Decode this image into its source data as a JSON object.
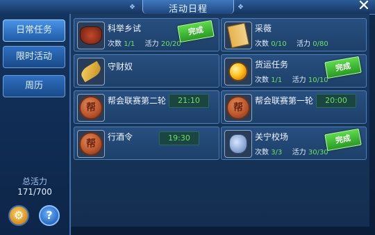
{
  "window": {
    "title": "活动日程",
    "close_label": "✕"
  },
  "sidebar": {
    "tabs": [
      {
        "label": "日常任务",
        "active": true
      },
      {
        "label": "限时活动",
        "active": false
      },
      {
        "label": "周历",
        "active": false
      }
    ],
    "vitality": {
      "label": "总活力",
      "value": "171/700"
    },
    "buttons": {
      "settings_icon": "gear-icon",
      "help_label": "?"
    }
  },
  "labels": {
    "count": "次数",
    "vitality": "活力",
    "done": "完成"
  },
  "activities": [
    {
      "name": "科举乡试",
      "icon": "seal-icon",
      "count": "1/1",
      "vitality": "20/20",
      "done": true,
      "time": ""
    },
    {
      "name": "采薇",
      "icon": "book-icon",
      "count": "0/10",
      "vitality": "0/80",
      "done": false,
      "time": ""
    },
    {
      "name": "守财奴",
      "icon": "leaf-icon",
      "count": "",
      "vitality": "",
      "done": false,
      "time": ""
    },
    {
      "name": "货运任务",
      "icon": "orb-icon",
      "count": "1/1",
      "vitality": "10/10",
      "done": true,
      "time": ""
    },
    {
      "name": "帮会联赛第二轮",
      "icon": "coin-icon",
      "count": "",
      "vitality": "",
      "done": false,
      "time": "21:10"
    },
    {
      "name": "帮会联赛第一轮",
      "icon": "coin-icon",
      "count": "",
      "vitality": "",
      "done": false,
      "time": "20:00"
    },
    {
      "name": "行酒令",
      "icon": "coin-icon",
      "count": "",
      "vitality": "",
      "done": false,
      "time": "19:30"
    },
    {
      "name": "关宁校场",
      "icon": "bag-icon",
      "count": "3/3",
      "vitality": "30/30",
      "done": true,
      "time": ""
    }
  ],
  "colors": {
    "accent": "#6fe06a",
    "done_green": "#3fbf32",
    "panel_blue": "#1d4069"
  }
}
